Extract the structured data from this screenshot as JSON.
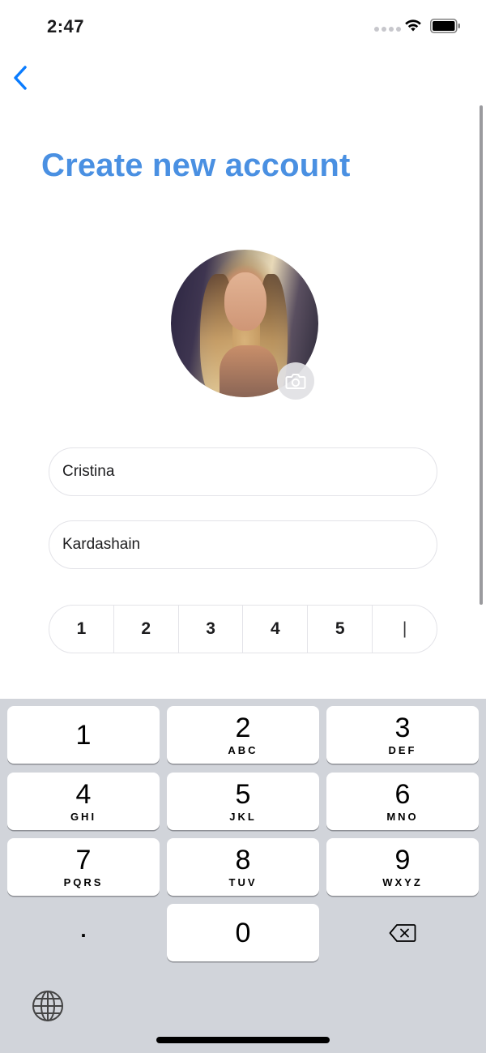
{
  "status_bar": {
    "time": "2:47",
    "icons": [
      "signal-dots-icon",
      "wifi-icon",
      "battery-icon"
    ]
  },
  "nav": {
    "back_icon": "chevron-left-icon",
    "accent_color": "#0a7cff"
  },
  "page": {
    "title": "Create new account",
    "title_color": "#4a90e2"
  },
  "avatar": {
    "camera_icon": "camera-icon"
  },
  "form": {
    "first_name": "Cristina",
    "last_name": "Kardashain",
    "code_digits": [
      "1",
      "2",
      "3",
      "4",
      "5",
      "|"
    ]
  },
  "keyboard": {
    "keys": [
      {
        "digit": "1",
        "letters": ""
      },
      {
        "digit": "2",
        "letters": "ABC"
      },
      {
        "digit": "3",
        "letters": "DEF"
      },
      {
        "digit": "4",
        "letters": "GHI"
      },
      {
        "digit": "5",
        "letters": "JKL"
      },
      {
        "digit": "6",
        "letters": "MNO"
      },
      {
        "digit": "7",
        "letters": "PQRS"
      },
      {
        "digit": "8",
        "letters": "TUV"
      },
      {
        "digit": "9",
        "letters": "WXYZ"
      },
      {
        "digit": "0",
        "letters": ""
      }
    ],
    "dot_key": ".",
    "delete_icon": "backspace-icon",
    "globe_icon": "globe-icon",
    "background": "#d1d4da"
  }
}
